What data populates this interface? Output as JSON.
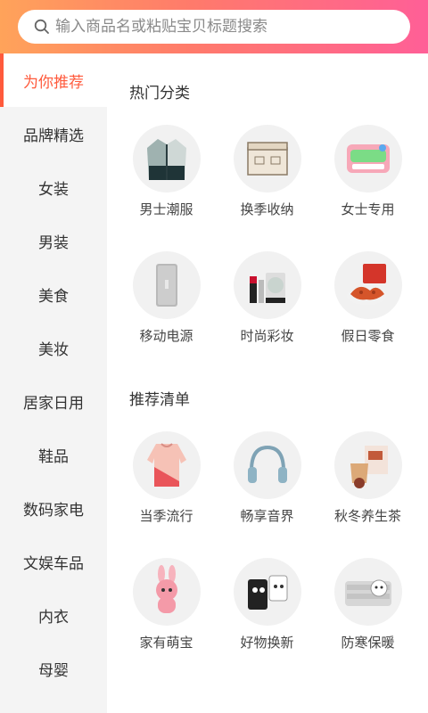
{
  "search": {
    "placeholder": "输入商品名或粘贴宝贝标题搜索"
  },
  "sidebar": {
    "items": [
      {
        "label": "为你推荐"
      },
      {
        "label": "品牌精选"
      },
      {
        "label": "女装"
      },
      {
        "label": "男装"
      },
      {
        "label": "美食"
      },
      {
        "label": "美妆"
      },
      {
        "label": "居家日用"
      },
      {
        "label": "鞋品"
      },
      {
        "label": "数码家电"
      },
      {
        "label": "文娱车品"
      },
      {
        "label": "内衣"
      },
      {
        "label": "母婴"
      }
    ]
  },
  "main": {
    "hot_title": "热门分类",
    "hot": [
      {
        "label": "男士潮服",
        "icon": "jacket-icon"
      },
      {
        "label": "换季收纳",
        "icon": "storage-box-icon"
      },
      {
        "label": "女士专用",
        "icon": "sanitary-pad-icon"
      },
      {
        "label": "移动电源",
        "icon": "power-bank-icon"
      },
      {
        "label": "时尚彩妆",
        "icon": "lipstick-icon"
      },
      {
        "label": "假日零食",
        "icon": "snack-icon"
      }
    ],
    "rec_title": "推荐清单",
    "rec": [
      {
        "label": "当季流行",
        "icon": "sweater-icon"
      },
      {
        "label": "畅享音界",
        "icon": "headphones-icon"
      },
      {
        "label": "秋冬养生茶",
        "icon": "tea-icon"
      },
      {
        "label": "家有萌宝",
        "icon": "bunny-toy-icon"
      },
      {
        "label": "好物换新",
        "icon": "cup-icon"
      },
      {
        "label": "防寒保暖",
        "icon": "electric-blanket-icon"
      }
    ]
  }
}
